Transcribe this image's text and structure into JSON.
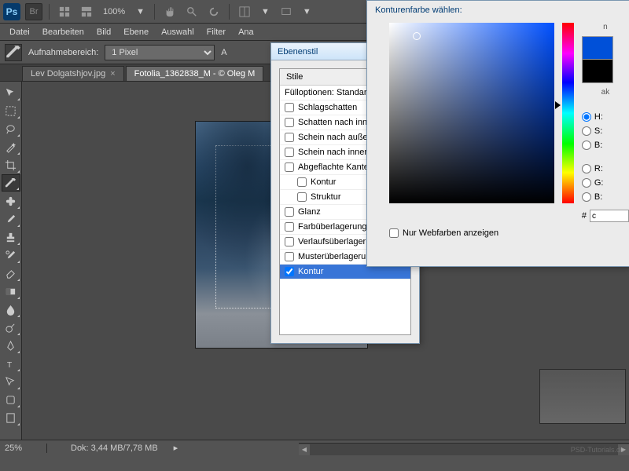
{
  "topbar": {
    "zoom": "100%",
    "chevron": "▼"
  },
  "menu": [
    "Datei",
    "Bearbeiten",
    "Bild",
    "Ebene",
    "Auswahl",
    "Filter",
    "Ana"
  ],
  "optbar": {
    "label": "Aufnahmebereich:",
    "value": "1 Pixel",
    "extra": "A"
  },
  "tabs": [
    {
      "label": "Lev Dolgatshjov.jpg",
      "close": "×"
    },
    {
      "label": "Fotolia_1362838_M - © Oleg M",
      "close": ""
    }
  ],
  "status": {
    "zoom": "25%",
    "doc": "Dok: 3,44 MB/7,78 MB",
    "arrow": "▸"
  },
  "layerDialog": {
    "title": "Ebenenstil",
    "header": "Stile",
    "fill": "Fülloptionen: Standard",
    "items": [
      {
        "label": "Schlagschatten",
        "checked": false,
        "indent": false
      },
      {
        "label": "Schatten nach innen",
        "checked": false,
        "indent": false
      },
      {
        "label": "Schein nach außen",
        "checked": false,
        "indent": false
      },
      {
        "label": "Schein nach innen",
        "checked": false,
        "indent": false
      },
      {
        "label": "Abgeflachte Kante",
        "checked": false,
        "indent": false
      },
      {
        "label": "Kontur",
        "checked": false,
        "indent": true
      },
      {
        "label": "Struktur",
        "checked": false,
        "indent": true
      },
      {
        "label": "Glanz",
        "checked": false,
        "indent": false
      },
      {
        "label": "Farbüberlagerung",
        "checked": false,
        "indent": false
      },
      {
        "label": "Verlaufsüberlagerung",
        "checked": false,
        "indent": false
      },
      {
        "label": "Musterüberlagerung",
        "checked": false,
        "indent": false
      },
      {
        "label": "Kontur",
        "checked": true,
        "indent": false,
        "selected": true
      }
    ]
  },
  "colorDialog": {
    "title": "Konturenfarbe wählen:",
    "newLabel": "n",
    "aktLabel": "ak",
    "radios": [
      "H:",
      "S:",
      "B:",
      "R:",
      "G:",
      "B:"
    ],
    "hexLabel": "#",
    "hexValue": "c",
    "webLabel": "Nur Webfarben anzeigen"
  },
  "watermark": "PSD-Tutorials.de"
}
